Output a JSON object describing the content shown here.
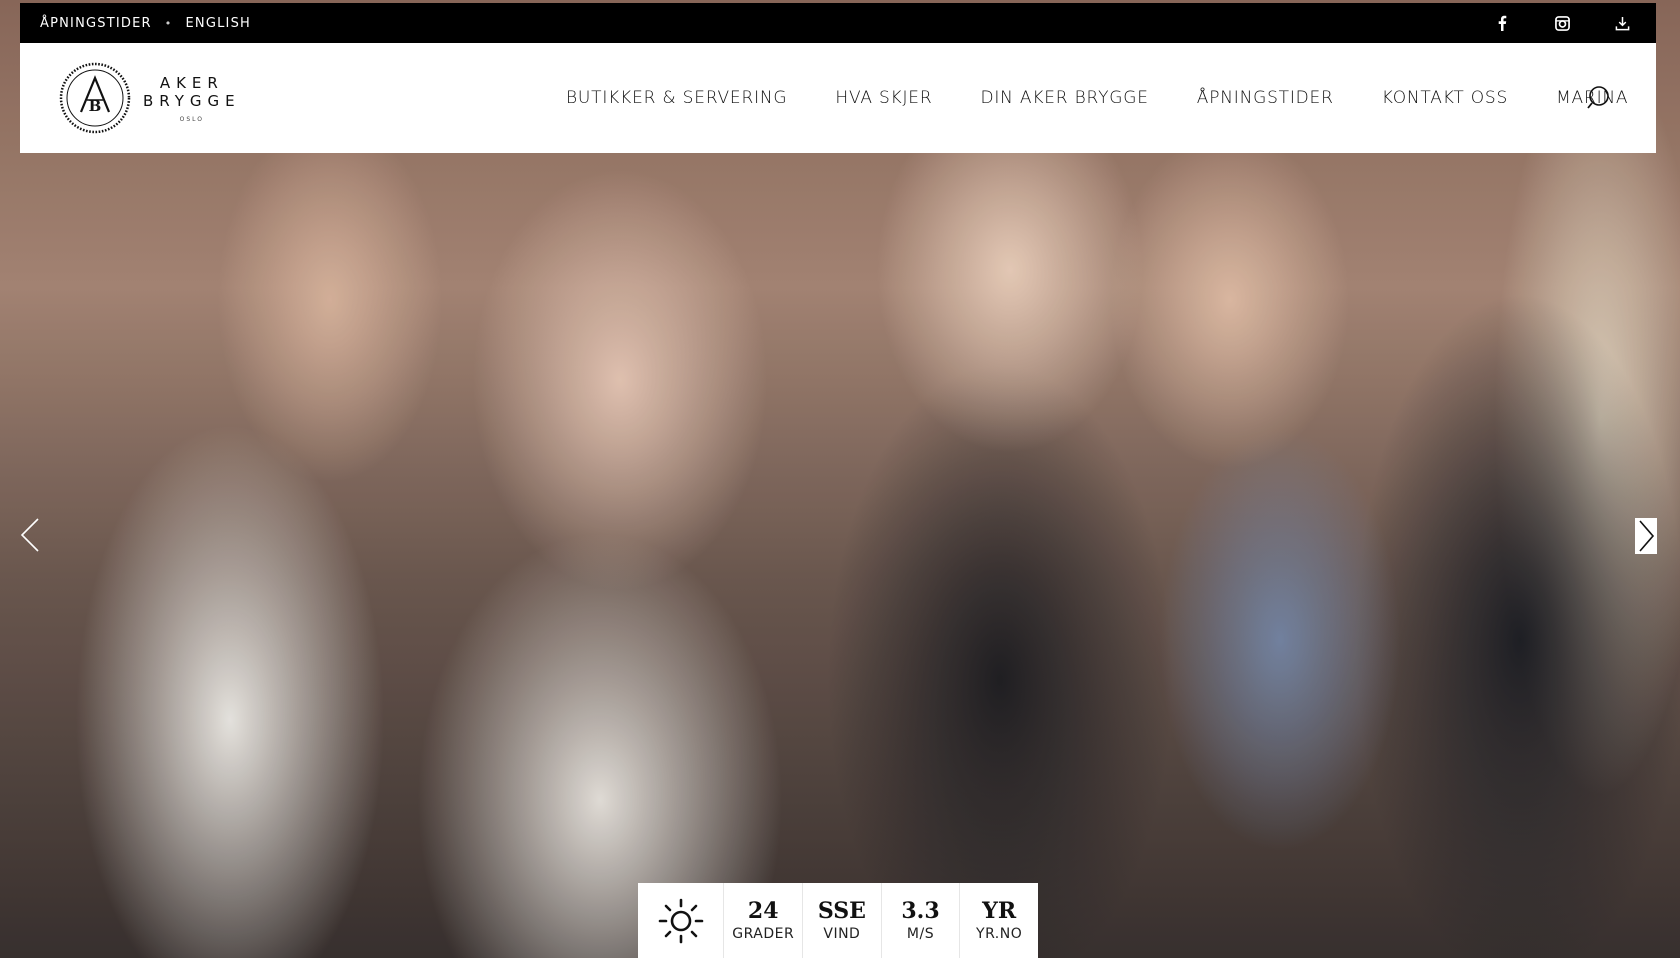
{
  "topbar": {
    "links": [
      "ÅPNINGSTIDER",
      "ENGLISH"
    ],
    "separator": "•",
    "socials": [
      "facebook-icon",
      "instagram-icon",
      "download-icon"
    ]
  },
  "header": {
    "logo": {
      "line1": "AKER",
      "line2": "BRYGGE",
      "line3": "OSLO",
      "monogram": "AB"
    },
    "nav": [
      "BUTIKKER & SERVERING",
      "HVA SKJER",
      "DIN AKER BRYGGE",
      "ÅPNINGSTIDER",
      "KONTAKT OSS",
      "MARINA"
    ],
    "search_icon": "search-icon"
  },
  "slider": {
    "prev_icon": "chevron-left-icon",
    "next_icon": "chevron-right-icon"
  },
  "weather": {
    "icon": "sun-icon",
    "temperature": {
      "value": "24",
      "label": "GRADER"
    },
    "wind_direction": {
      "value": "SSE",
      "label": "VIND"
    },
    "wind_speed": {
      "value": "3.3",
      "label": "M/S"
    },
    "source": {
      "value": "YR",
      "label": "YR.NO"
    }
  }
}
